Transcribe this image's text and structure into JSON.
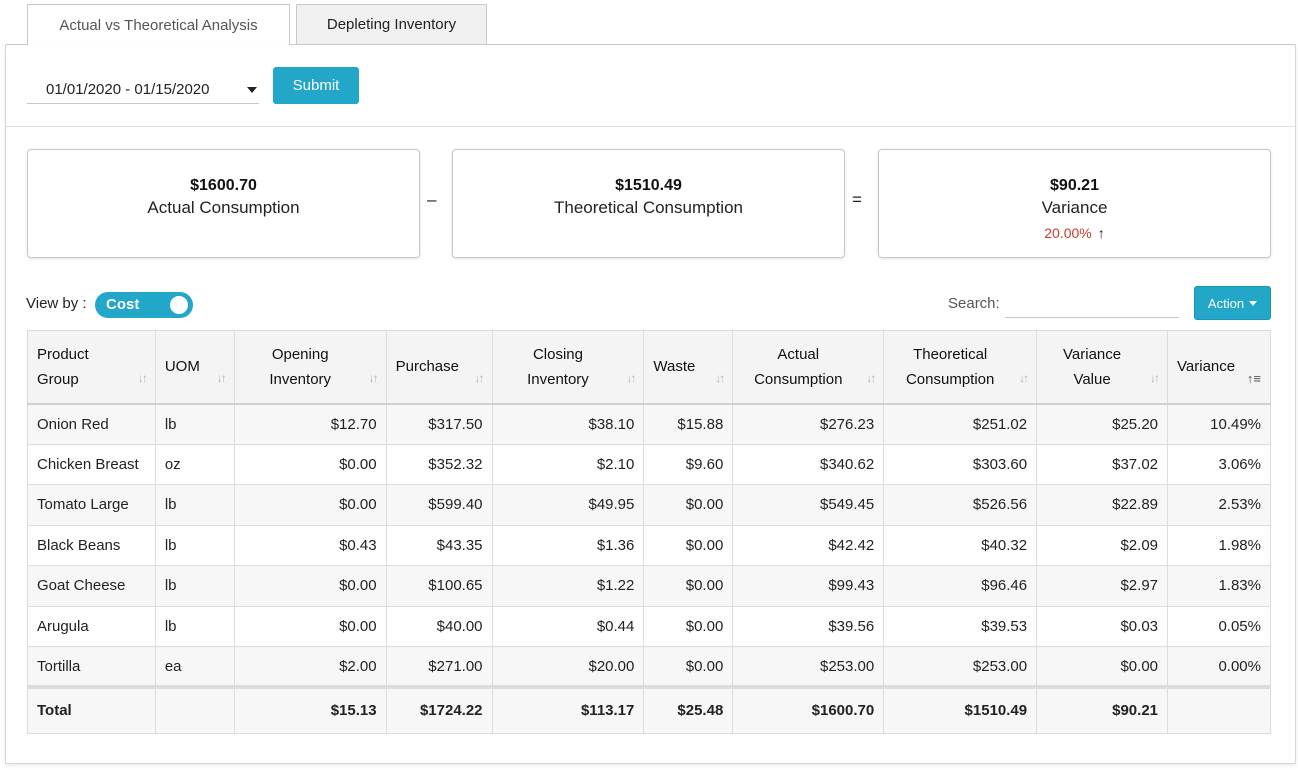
{
  "tabs": [
    {
      "label": "Actual vs Theoretical Analysis",
      "active": true
    },
    {
      "label": "Depleting Inventory",
      "active": false
    }
  ],
  "filters": {
    "date_range": "01/01/2020 - 01/15/2020",
    "submit_label": "Submit"
  },
  "summary": {
    "actual": {
      "amount": "$1600.70",
      "label": "Actual Consumption"
    },
    "minus": "–",
    "theoretical": {
      "amount": "$1510.49",
      "label": "Theoretical Consumption"
    },
    "equals": "=",
    "variance": {
      "amount": "$90.21",
      "label": "Variance",
      "percent": "20.00%",
      "trend_icon": "arrow-up-icon"
    }
  },
  "controls": {
    "view_by_label": "View by :",
    "toggle_label": "Cost",
    "search_label": "Search:",
    "search_value": "",
    "action_label": "Action"
  },
  "table": {
    "headers": [
      {
        "line1": "Product",
        "line2": "Group"
      },
      {
        "line1": "",
        "line2": "UOM"
      },
      {
        "line1": "Opening",
        "line2": "Inventory"
      },
      {
        "line1": "",
        "line2": "Purchase"
      },
      {
        "line1": "Closing",
        "line2": "Inventory"
      },
      {
        "line1": "",
        "line2": "Waste"
      },
      {
        "line1": "Actual",
        "line2": "Consumption"
      },
      {
        "line1": "Theoretical",
        "line2": "Consumption"
      },
      {
        "line1": "Variance",
        "line2": "Value"
      },
      {
        "line1": "",
        "line2": "Variance"
      }
    ],
    "rows": [
      [
        "Onion Red",
        "lb",
        "$12.70",
        "$317.50",
        "$38.10",
        "$15.88",
        "$276.23",
        "$251.02",
        "$25.20",
        "10.49%"
      ],
      [
        "Chicken Breast",
        "oz",
        "$0.00",
        "$352.32",
        "$2.10",
        "$9.60",
        "$340.62",
        "$303.60",
        "$37.02",
        "3.06%"
      ],
      [
        "Tomato Large",
        "lb",
        "$0.00",
        "$599.40",
        "$49.95",
        "$0.00",
        "$549.45",
        "$526.56",
        "$22.89",
        "2.53%"
      ],
      [
        "Black Beans",
        "lb",
        "$0.43",
        "$43.35",
        "$1.36",
        "$0.00",
        "$42.42",
        "$40.32",
        "$2.09",
        "1.98%"
      ],
      [
        "Goat Cheese",
        "lb",
        "$0.00",
        "$100.65",
        "$1.22",
        "$0.00",
        "$99.43",
        "$96.46",
        "$2.97",
        "1.83%"
      ],
      [
        "Arugula",
        "lb",
        "$0.00",
        "$40.00",
        "$0.44",
        "$0.00",
        "$39.56",
        "$39.53",
        "$0.03",
        "0.05%"
      ],
      [
        "Tortilla",
        "ea",
        "$2.00",
        "$271.00",
        "$20.00",
        "$0.00",
        "$253.00",
        "$253.00",
        "$0.00",
        "0.00%"
      ]
    ],
    "total": [
      "Total",
      "",
      "$15.13",
      "$1724.22",
      "$113.17",
      "$25.48",
      "$1600.70",
      "$1510.49",
      "$90.21",
      ""
    ]
  },
  "colors": {
    "accent": "#22a7c8",
    "negative": "#cc3a2c"
  }
}
